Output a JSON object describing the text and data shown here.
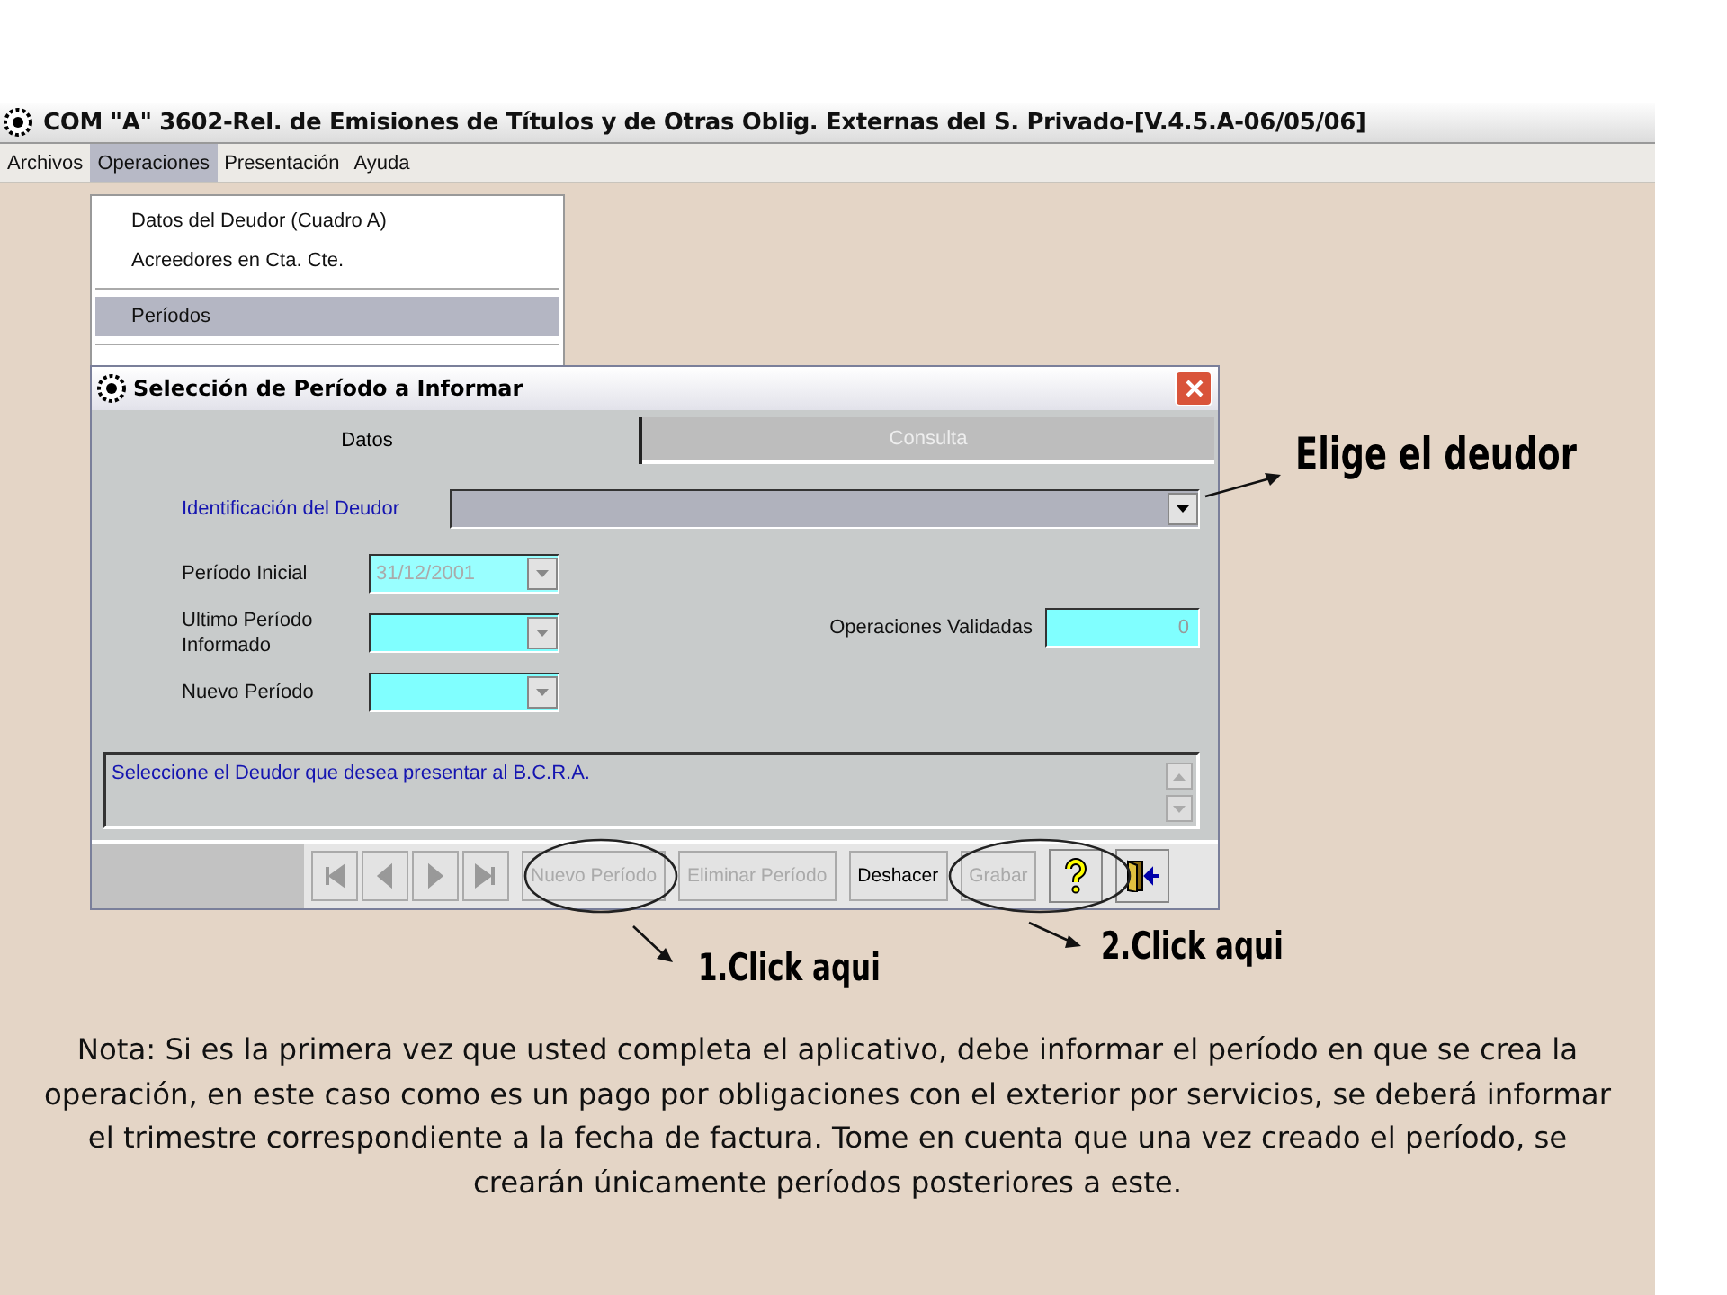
{
  "window": {
    "title": "COM \"A\" 3602-Rel. de Emisiones de Títulos y de Otras Oblig. Externas del S. Privado-[V.4.5.A-06/05/06]"
  },
  "menubar": [
    {
      "label": "Archivos",
      "selected": false
    },
    {
      "label": "Operaciones",
      "selected": true
    },
    {
      "label": "Presentación",
      "selected": false
    },
    {
      "label": "Ayuda",
      "selected": false
    }
  ],
  "menu": {
    "groups": [
      [
        {
          "label": "Datos del Deudor (Cuadro A)",
          "selected": false
        },
        {
          "label": "Acreedores en Cta. Cte.",
          "selected": false
        }
      ],
      [
        {
          "label": "Períodos",
          "selected": true
        }
      ]
    ]
  },
  "dialog": {
    "title": "Selección de Período a Informar",
    "tabs": [
      {
        "label": "Datos",
        "selected": true
      },
      {
        "label": "Consulta",
        "selected": false
      }
    ],
    "debtor": {
      "label": "Identificación del Deudor"
    },
    "fields": [
      {
        "label": "Período Inicial",
        "value": "31/12/2001",
        "disabled": true
      },
      {
        "label": "Ultimo Período Informado",
        "disabled": false
      },
      {
        "label": "Nuevo Período",
        "disabled": false
      }
    ],
    "validated": {
      "label": "Operaciones Validadas",
      "value": "0"
    },
    "message": "Seleccione el Deudor que desea presentar al B.C.R.A.",
    "nav": [
      {
        "kind": "first"
      },
      {
        "kind": "prev"
      },
      {
        "kind": "next"
      },
      {
        "kind": "last"
      }
    ],
    "buttons": [
      {
        "label": "Nuevo Período",
        "disabled": true,
        "circled": true
      },
      {
        "label": "Eliminar Período",
        "disabled": true,
        "circled": false
      },
      {
        "label": "Deshacer",
        "disabled": false,
        "circled": false
      },
      {
        "label": "Grabar",
        "disabled": true,
        "circled": true
      }
    ]
  },
  "annotations": {
    "choose": "Elige el deudor",
    "step1": "1.Click aqui",
    "step2": "2.Click aqui"
  },
  "note": "Nota: Si es la primera vez que usted completa el aplicativo, debe informar el período en que se crea la operación, en este caso como es un pago por obligaciones con el exterior por servicios, se deberá informar el trimestre correspondiente a la fecha de factura. Tome en cuenta que una vez creado el período, se crearán únicamente períodos posteriores a este."
}
